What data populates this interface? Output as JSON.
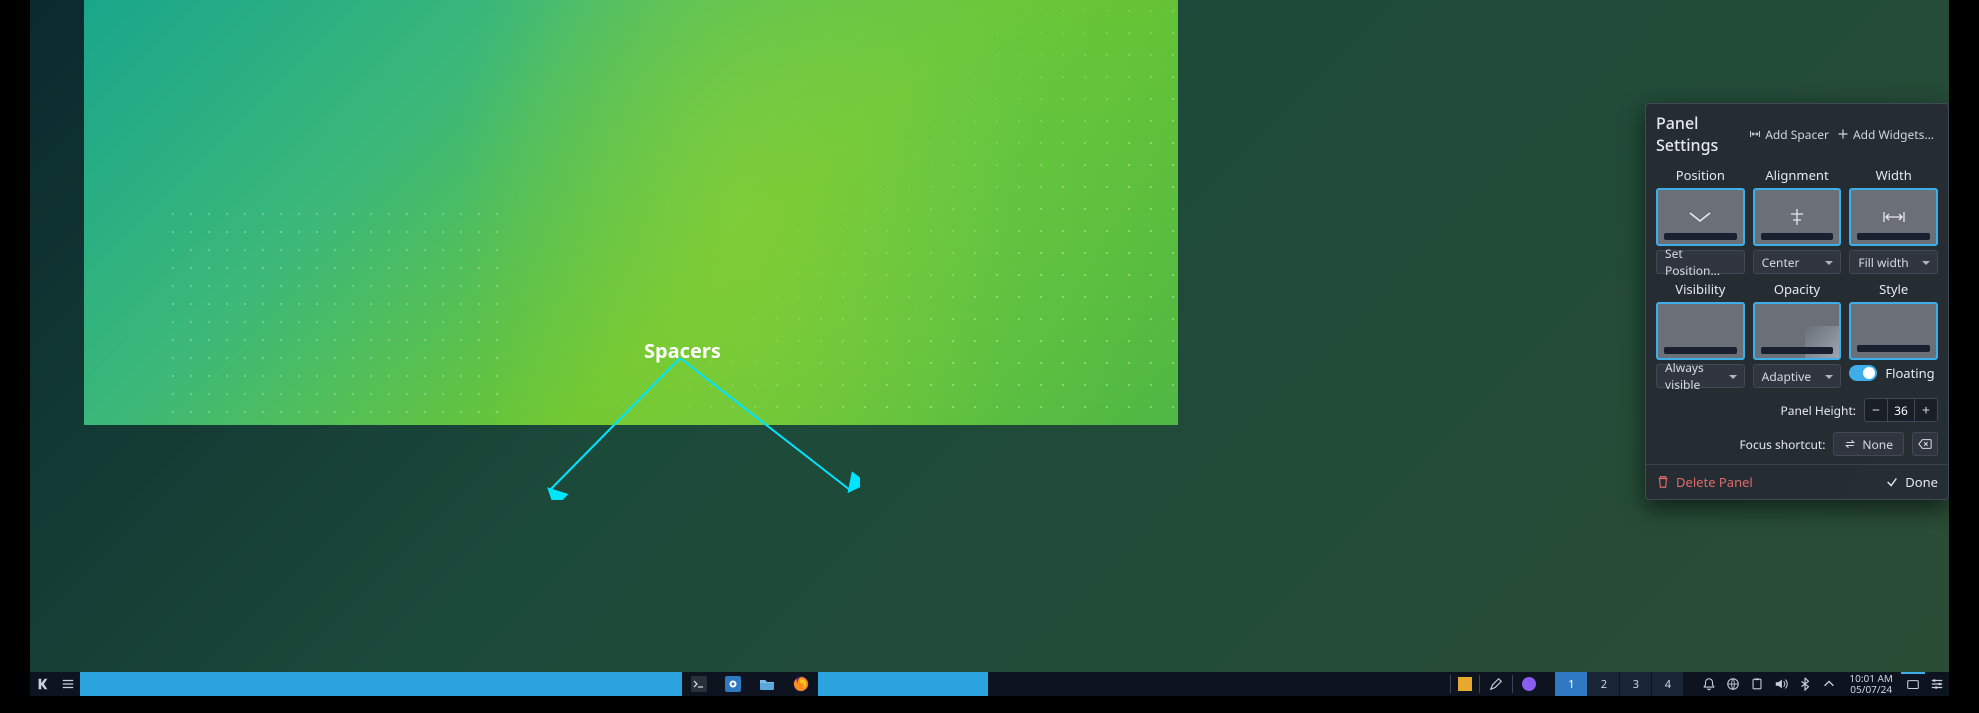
{
  "annotation": {
    "label": "Spacers"
  },
  "panel_settings": {
    "title": "Panel Settings",
    "add_spacer": "Add Spacer",
    "add_widgets": "Add Widgets...",
    "sections": {
      "position": {
        "label": "Position",
        "button": "Set Position..."
      },
      "alignment": {
        "label": "Alignment",
        "value": "Center"
      },
      "width": {
        "label": "Width",
        "value": "Fill width"
      },
      "visibility": {
        "label": "Visibility",
        "value": "Always visible"
      },
      "opacity": {
        "label": "Opacity",
        "value": "Adaptive"
      },
      "style": {
        "label": "Style",
        "floating": "Floating"
      }
    },
    "panel_height": {
      "label": "Panel Height:",
      "value": "36"
    },
    "focus_shortcut": {
      "label": "Focus shortcut:",
      "value": "None"
    },
    "delete": "Delete Panel",
    "done": "Done"
  },
  "taskbar": {
    "pager": [
      "1",
      "2",
      "3",
      "4"
    ],
    "clock": {
      "time": "10:01 AM",
      "date": "05/07/24"
    }
  }
}
